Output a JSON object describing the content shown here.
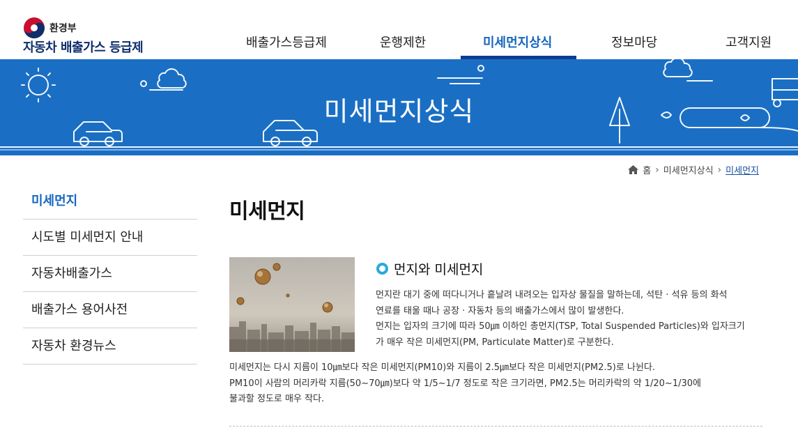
{
  "header": {
    "ministry": "환경부",
    "site_title": "자동차 배출가스 등급제"
  },
  "gnb": [
    {
      "label": "배출가스등급제"
    },
    {
      "label": "운행제한"
    },
    {
      "label": "미세먼지상식",
      "active": true
    },
    {
      "label": "정보마당"
    },
    {
      "label": "고객지원"
    }
  ],
  "banner": {
    "title": "미세먼지상식"
  },
  "breadcrumb": {
    "home": "홈",
    "level1": "미세먼지상식",
    "current": "미세먼지"
  },
  "sidebar": {
    "items": [
      {
        "label": "미세먼지",
        "active": true
      },
      {
        "label": "시도별 미세먼지 안내"
      },
      {
        "label": "자동차배출가스"
      },
      {
        "label": "배출가스 용어사전"
      },
      {
        "label": "자동차 환경뉴스"
      }
    ]
  },
  "main": {
    "page_title": "미세먼지",
    "section_title": "먼지와 미세먼지",
    "para1": [
      "먼지란 대기 중에 떠다니거나 흩날려 내려오는 입자상 물질을 말하는데, 석탄 · 석유 등의 화석",
      "연료를 태울 때나 공장 · 자동차 등의 배출가스에서 많이 발생한다.",
      "먼지는 입자의 크기에 따라 50㎛ 이하인 총먼지(TSP, Total Suspended Particles)와 입자크기",
      "가 매우 작은 미세먼지(PM, Particulate Matter)로 구분한다."
    ],
    "para2": [
      "미세먼지는 다시 지름이 10㎛보다 작은 미세먼지(PM10)와 지름이 2.5㎛보다 작은 미세먼지(PM2.5)로 나뉜다.",
      "PM10이 사람의 머리카락 지름(50~70㎛)보다 약 1/5~1/7 정도로 작은 크기라면, PM2.5는 머리카락의 약 1/20~1/30에",
      "불과할 정도로 매우 작다."
    ]
  },
  "colors": {
    "brand_navy": "#0f2f6b",
    "active_blue": "#1565c0",
    "banner_blue": "#1a6fc4",
    "accent_ring": "#29a8e0"
  }
}
